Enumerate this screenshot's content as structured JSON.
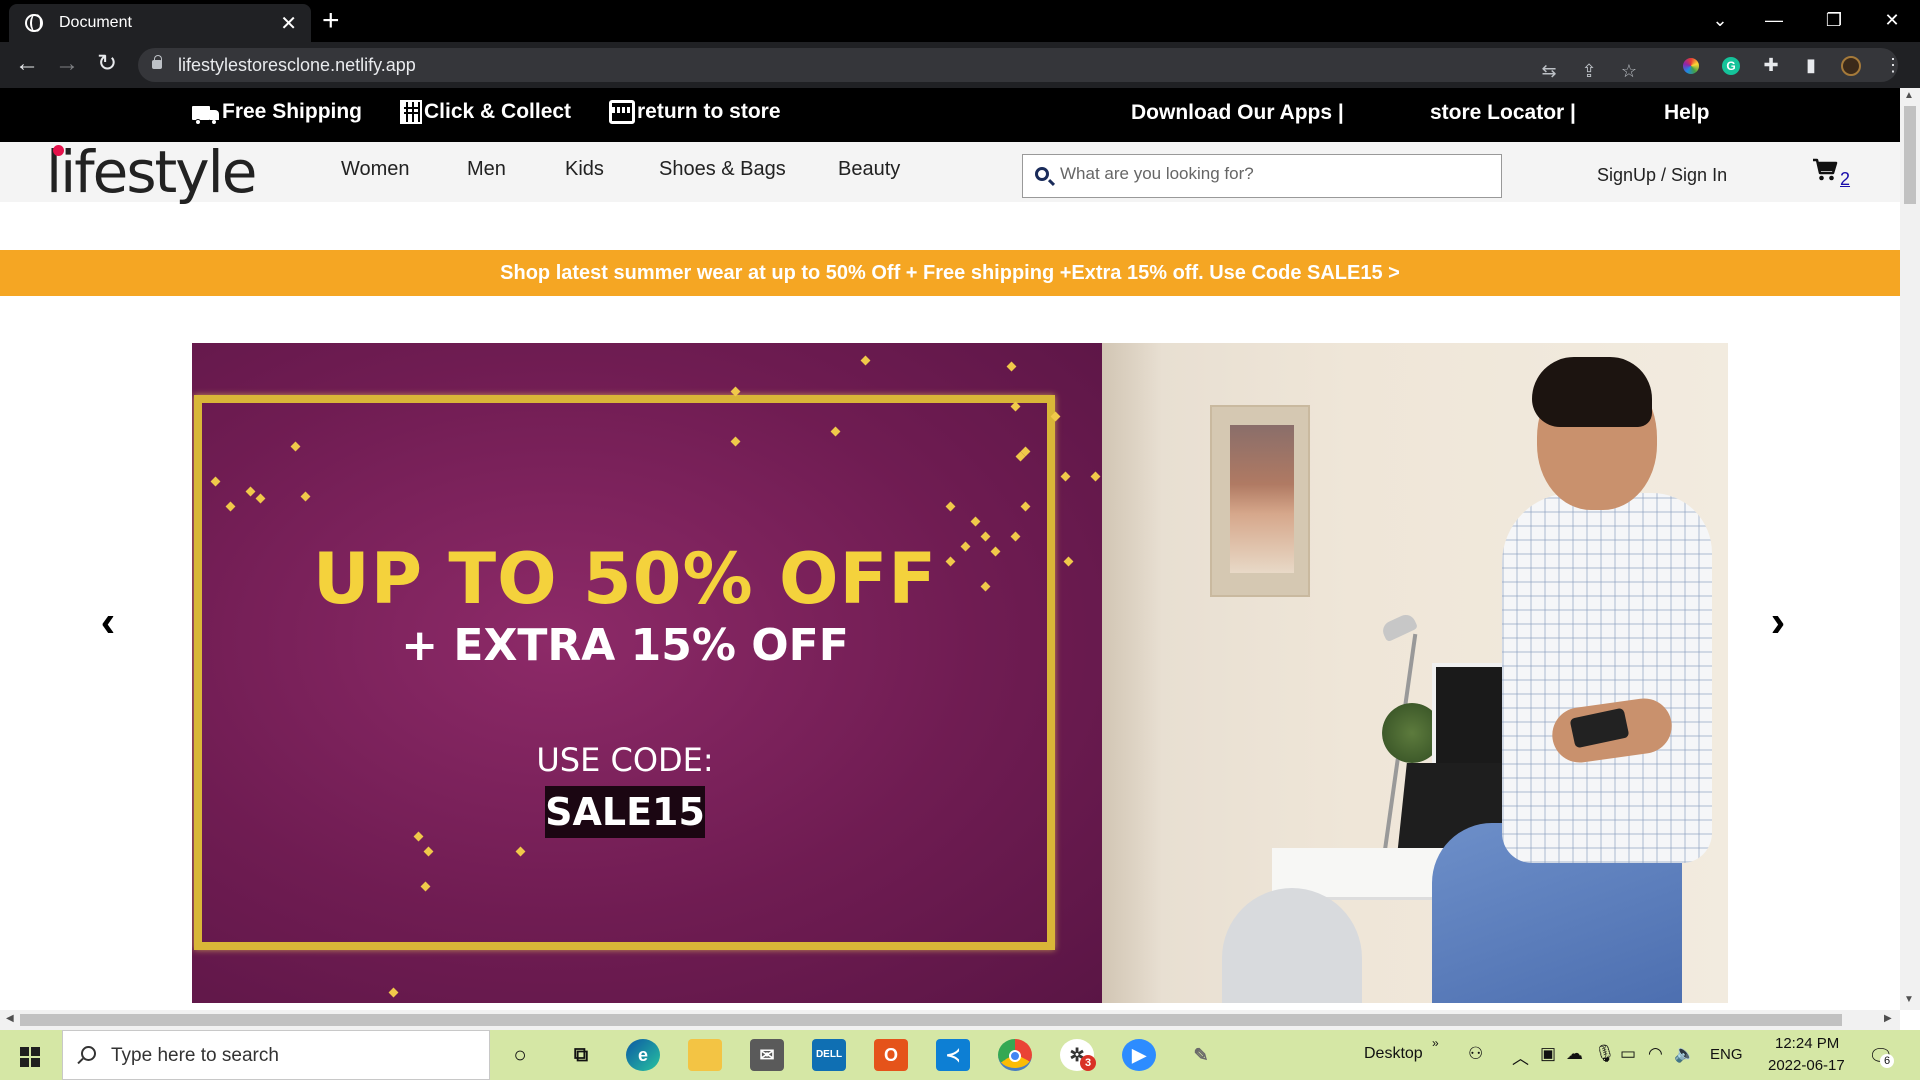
{
  "browser": {
    "tab_title": "Document",
    "tab_close": "✕",
    "new_tab": "+",
    "url": "lifestylestoresclone.netlify.app",
    "controls": {
      "dropdown": "⌄",
      "minimize": "—",
      "restore": "❐",
      "close": "✕"
    }
  },
  "infobar": {
    "free_shipping": "Free Shipping",
    "click_collect": "Click & Collect",
    "return_store": "return to store",
    "download_apps": "Download Our Apps |",
    "store_locator": "store Locator |",
    "help": "Help"
  },
  "header": {
    "logo": "lifestyle",
    "nav": [
      "Women",
      "Men",
      "Kids",
      "Shoes & Bags",
      "Beauty"
    ],
    "search_placeholder": "What are you looking for?",
    "signin": "SignUp / Sign In",
    "cart_count": "2"
  },
  "promo": {
    "text": "Shop latest summer wear at up to 50% Off + Free shipping +Extra 15% off. Use Code SALE15 >",
    "color": "#f5a623"
  },
  "banner": {
    "headline": "UP TO 50% OFF",
    "subline": "+ EXTRA 15% OFF",
    "code_label": "USE CODE:",
    "code": "SALE15",
    "prev": "‹",
    "next": "›"
  },
  "taskbar": {
    "search_placeholder": "Type here to search",
    "desktop_label": "Desktop",
    "language": "ENG",
    "time": "12:24 PM",
    "date": "2022-06-17",
    "notifications": "6",
    "badge": "3"
  }
}
